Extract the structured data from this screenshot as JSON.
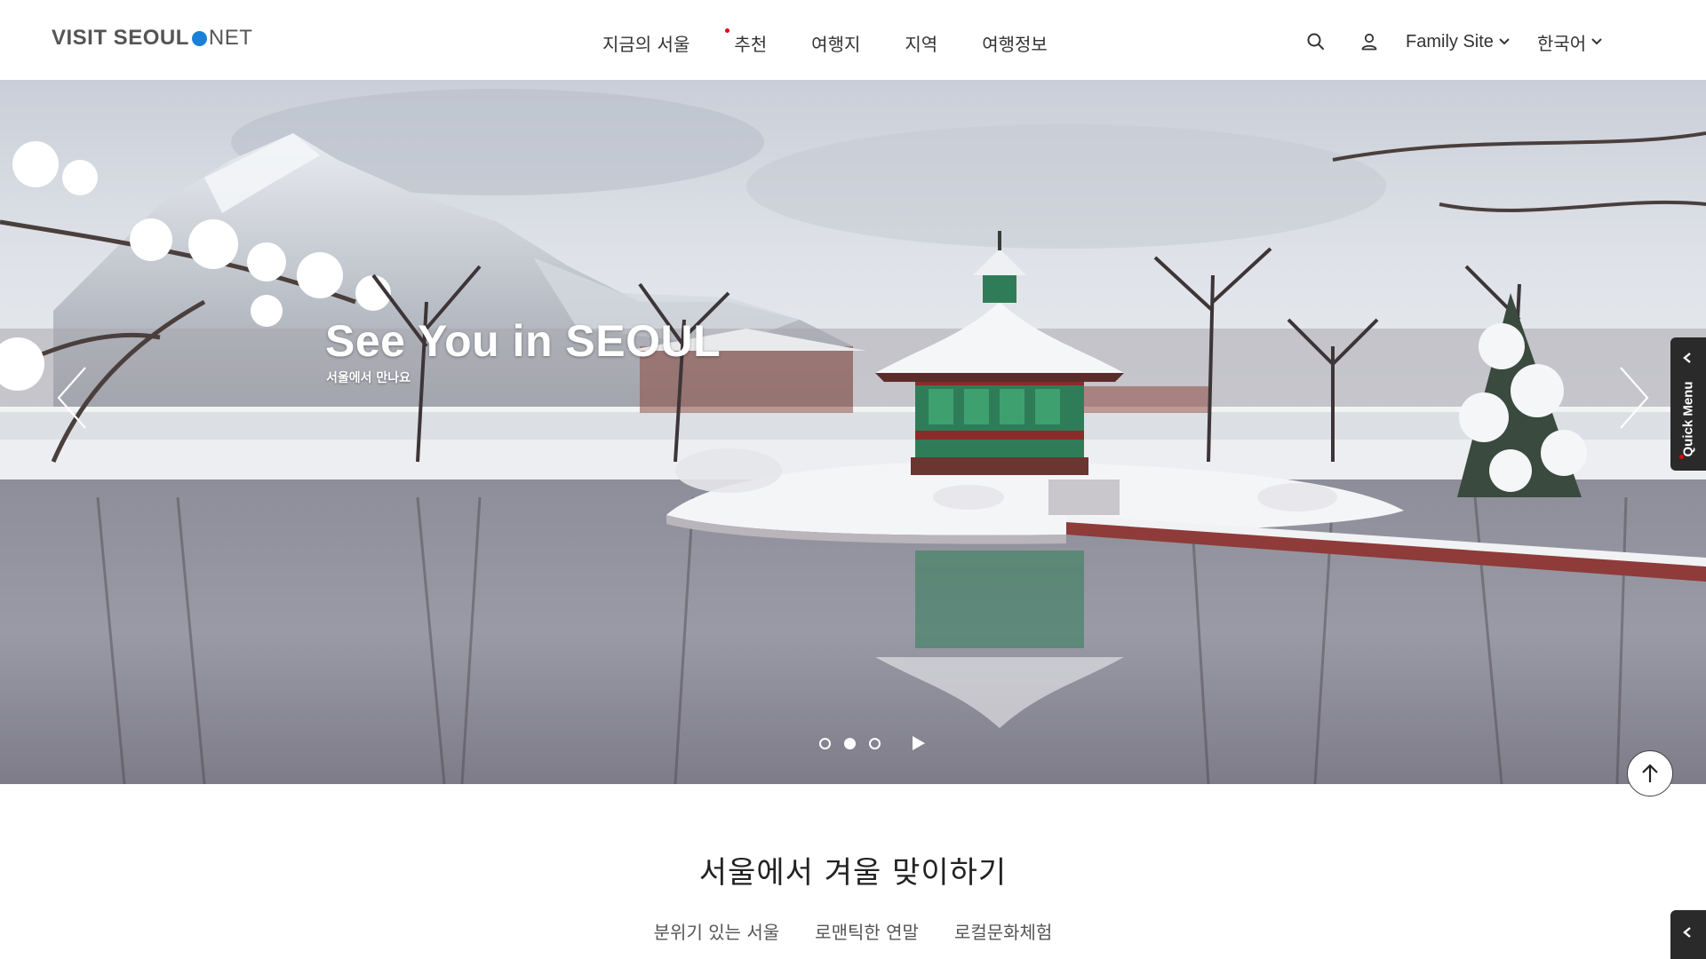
{
  "header": {
    "logo_part1": "VISIT SEOUL",
    "logo_part2": "NET",
    "nav": [
      {
        "label": "지금의 서울"
      },
      {
        "label": "추천",
        "has_new_dot": true
      },
      {
        "label": "여행지"
      },
      {
        "label": "지역"
      },
      {
        "label": "여행정보"
      }
    ],
    "search_icon": "search-icon",
    "user_icon": "user-icon",
    "family_site": "Family Site",
    "language": "한국어"
  },
  "hero": {
    "title": "See You in SEOUL",
    "subtitle": "서울에서 만나요",
    "slide_count": 3,
    "active_slide": 2,
    "image": "snowy-palace-pavilion-reflected-in-pond"
  },
  "quick_menu": {
    "label": "Quick Menu"
  },
  "section": {
    "title": "서울에서 겨울 맞이하기",
    "tabs": [
      "분위기 있는 서울",
      "로맨틱한 연말",
      "로컬문화체험"
    ]
  },
  "colors": {
    "brand_blue": "#1a7fd6",
    "new_dot": "#e60012",
    "quick_menu_bg": "#2a2a2a"
  }
}
